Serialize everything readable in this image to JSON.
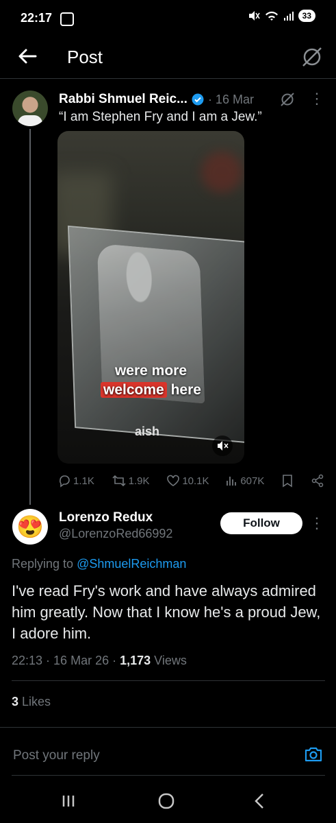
{
  "status": {
    "time": "22:17",
    "battery": "33"
  },
  "header": {
    "title": "Post"
  },
  "post": {
    "author_name": "Rabbi Shmuel Reic...",
    "date": "· 16 Mar",
    "text": "“I am Stephen Fry and I am a Jew.”",
    "video": {
      "caption_line1": "were more",
      "caption_highlight": "welcome",
      "caption_rest": " here",
      "watermark": "aish"
    },
    "stats": {
      "replies": "1.1K",
      "reposts": "1.9K",
      "likes": "10.1K",
      "views": "607K"
    }
  },
  "reply": {
    "author_name": "Lorenzo Redux",
    "handle": "@LorenzoRed66992",
    "follow_label": "Follow",
    "replying_prefix": "Replying to ",
    "replying_to": "@ShmuelReichman",
    "body": "I've read Fry's work and have always admired him greatly. Now that I know he's a proud Jew, I adore him.",
    "time": "22:13",
    "date": "16 Mar 26",
    "views_count": "1,173",
    "views_label": "Views",
    "likes_count": "3",
    "likes_label": "Likes"
  },
  "composer": {
    "placeholder": "Post your reply"
  },
  "colors": {
    "accent": "#1d9bf0",
    "background": "#000000",
    "muted": "#71767b",
    "highlight": "#d9342b"
  },
  "icons": [
    "back-arrow-icon",
    "grok-icon",
    "verified-badge-icon",
    "more-icon",
    "mute-icon",
    "reply-icon",
    "repost-icon",
    "like-icon",
    "views-icon",
    "bookmark-icon",
    "share-icon",
    "camera-icon",
    "recents-icon",
    "home-icon",
    "back-nav-icon"
  ]
}
